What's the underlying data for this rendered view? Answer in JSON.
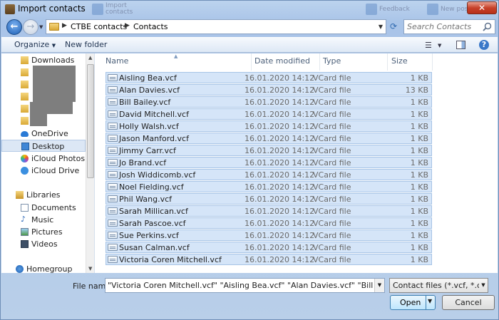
{
  "window": {
    "title": "Import contacts",
    "close_label": "✕",
    "background_items": [
      "Import\ncontacts",
      "Feedback",
      "New posts"
    ]
  },
  "nav": {
    "back_icon": "back-arrow-icon",
    "forward_icon": "forward-arrow-icon",
    "breadcrumbs": [
      "CTBE contacts",
      "Contacts"
    ],
    "search_placeholder": "Search Contacts"
  },
  "toolbar": {
    "organize_label": "Organize",
    "new_folder_label": "New folder"
  },
  "sidebar": {
    "items": [
      {
        "label": "Downloads",
        "icon": "downloads-folder-icon"
      },
      {
        "label": "OneDrive",
        "icon": "cloud-icon"
      },
      {
        "label": "Desktop",
        "icon": "desktop-icon",
        "selected": true
      },
      {
        "label": "iCloud Photos",
        "icon": "icloud-photos-icon"
      },
      {
        "label": "iCloud Drive",
        "icon": "icloud-drive-icon"
      },
      {
        "label": "Libraries",
        "icon": "libraries-icon"
      },
      {
        "label": "Documents",
        "icon": "documents-icon"
      },
      {
        "label": "Music",
        "icon": "music-icon"
      },
      {
        "label": "Pictures",
        "icon": "pictures-icon"
      },
      {
        "label": "Videos",
        "icon": "videos-icon"
      },
      {
        "label": "Homegroup",
        "icon": "homegroup-icon"
      }
    ]
  },
  "columns": {
    "name": "Name",
    "date": "Date modified",
    "type": "Type",
    "size": "Size"
  },
  "files": [
    {
      "name": "Aisling Bea.vcf",
      "date": "16.01.2020 14:12",
      "type": "VCard file",
      "size": "1 KB"
    },
    {
      "name": "Alan Davies.vcf",
      "date": "16.01.2020 14:12",
      "type": "VCard file",
      "size": "13 KB"
    },
    {
      "name": "Bill Bailey.vcf",
      "date": "16.01.2020 14:12",
      "type": "VCard file",
      "size": "1 KB"
    },
    {
      "name": "David Mitchell.vcf",
      "date": "16.01.2020 14:12",
      "type": "VCard file",
      "size": "1 KB"
    },
    {
      "name": "Holly Walsh.vcf",
      "date": "16.01.2020 14:12",
      "type": "VCard file",
      "size": "1 KB"
    },
    {
      "name": "Jason Manford.vcf",
      "date": "16.01.2020 14:12",
      "type": "VCard file",
      "size": "1 KB"
    },
    {
      "name": "Jimmy Carr.vcf",
      "date": "16.01.2020 14:12",
      "type": "VCard file",
      "size": "1 KB"
    },
    {
      "name": "Jo Brand.vcf",
      "date": "16.01.2020 14:12",
      "type": "VCard file",
      "size": "1 KB"
    },
    {
      "name": "Josh Widdicomb.vcf",
      "date": "16.01.2020 14:12",
      "type": "VCard file",
      "size": "1 KB"
    },
    {
      "name": "Noel Fielding.vcf",
      "date": "16.01.2020 14:12",
      "type": "VCard file",
      "size": "1 KB"
    },
    {
      "name": "Phil Wang.vcf",
      "date": "16.01.2020 14:12",
      "type": "VCard file",
      "size": "1 KB"
    },
    {
      "name": "Sarah Millican.vcf",
      "date": "16.01.2020 14:12",
      "type": "VCard file",
      "size": "1 KB"
    },
    {
      "name": "Sarah Pascoe.vcf",
      "date": "16.01.2020 14:12",
      "type": "VCard file",
      "size": "1 KB"
    },
    {
      "name": "Sue Perkins.vcf",
      "date": "16.01.2020 14:12",
      "type": "VCard file",
      "size": "1 KB"
    },
    {
      "name": "Susan Calman.vcf",
      "date": "16.01.2020 14:12",
      "type": "VCard file",
      "size": "1 KB"
    },
    {
      "name": "Victoria Coren Mitchell.vcf",
      "date": "16.01.2020 14:12",
      "type": "VCard file",
      "size": "1 KB"
    }
  ],
  "footer": {
    "file_name_label": "File name:",
    "file_name_value": "\"Victoria Coren Mitchell.vcf\" \"Aisling Bea.vcf\" \"Alan Davies.vcf\" \"Bill Bailey.vcf\" \"David M",
    "filter_value": "Contact files (*.vcf, *.csv, *.xls",
    "open_label": "Open",
    "cancel_label": "Cancel"
  },
  "colors": {
    "selection": "#d5e5f8",
    "selection_border": "#a7c4e6",
    "accent": "#1d5fb5",
    "close": "#c7412a"
  }
}
